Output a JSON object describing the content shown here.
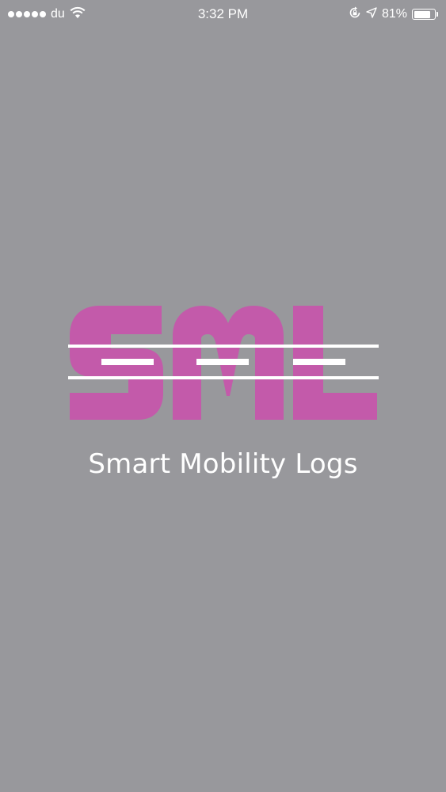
{
  "status_bar": {
    "carrier": "du",
    "time": "3:32 PM",
    "battery_percent": "81%",
    "battery_level": 0.81,
    "signal_strength": 5,
    "icons": [
      "wifi-icon",
      "rotation-lock-icon",
      "location-arrow-icon",
      "battery-icon"
    ]
  },
  "splash": {
    "logo_text": "SML",
    "logo_color": "#c35aaa",
    "title": "Smart Mobility Logs"
  },
  "colors": {
    "background": "#98989c",
    "text": "#ffffff"
  }
}
